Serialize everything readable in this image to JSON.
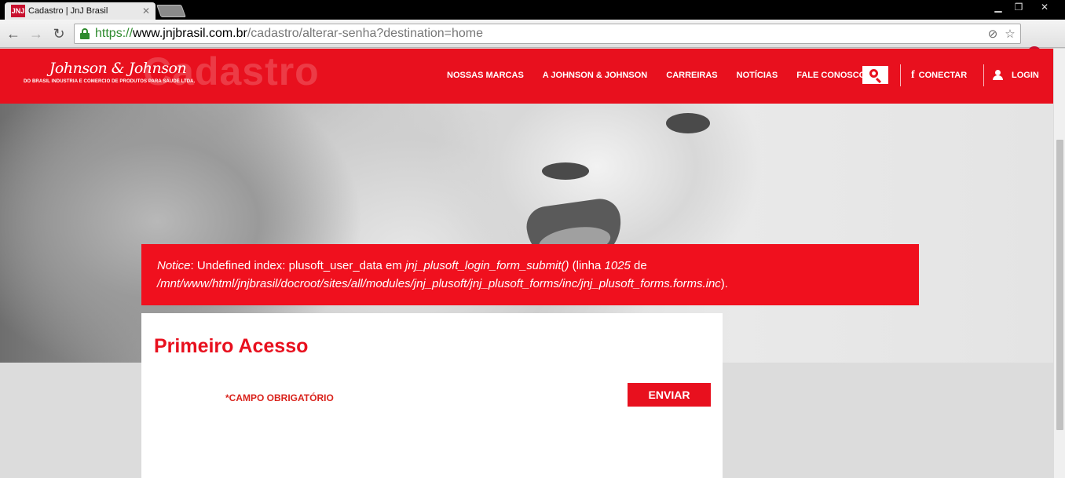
{
  "browser": {
    "tab_title": "Cadastro | JnJ Brasil",
    "tab_favicon_text": "JNJ",
    "url_scheme": "https://",
    "url_host": "www.jnjbrasil.com.br",
    "url_path": "/cadastro/alterar-senha?destination=home",
    "icons": [
      "back-icon",
      "forward-icon",
      "reload-icon",
      "lock-icon",
      "star-icon",
      "menu-icon"
    ]
  },
  "header": {
    "logo_script": "Johnson & Johnson",
    "logo_sub": "DO BRASIL INDUSTRIA E COMERCIO DE PRODUTOS PARA SAUDE LTDA.",
    "ghost_title": "Cadastro",
    "nav": [
      "NOSSAS MARCAS",
      "A JOHNSON & JOHNSON",
      "CARREIRAS",
      "NOTÍCIAS",
      "FALE CONOSCO"
    ],
    "connect_label": "CONECTAR",
    "login_label": "LOGIN"
  },
  "notice": {
    "label": "Notice",
    "text1": ": Undefined index: plusoft_user_data em ",
    "function": "jnj_plusoft_login_form_submit()",
    "text2": " (linha ",
    "line": "1025",
    "text3": " de ",
    "path": "/mnt/www/html/jnjbrasil/docroot/sites/all/modules/jnj_plusoft/jnj_plusoft_forms/inc/jnj_plusoft_forms.forms.inc",
    "text4": ")."
  },
  "form": {
    "title": "Primeiro Acesso",
    "required_label": "*CAMPO OBRIGATÓRIO",
    "submit_label": "ENVIAR"
  },
  "colors": {
    "brand_red": "#e8101e",
    "notice_red": "#f0101e"
  }
}
